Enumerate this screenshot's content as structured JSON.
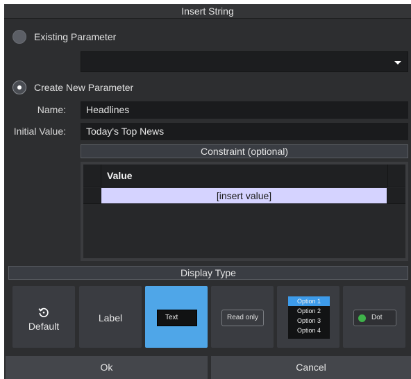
{
  "dialog": {
    "title": "Insert String"
  },
  "existing": {
    "label": "Existing Parameter",
    "selected": false,
    "dropdown_value": ""
  },
  "create": {
    "label": "Create New Parameter",
    "selected": true
  },
  "fields": {
    "name_label": "Name:",
    "name_value": "Headlines",
    "initial_label": "Initial Value:",
    "initial_value": "Today's Top News"
  },
  "constraint": {
    "header": "Constraint (optional)",
    "column": "Value",
    "rows": [
      "[insert value]"
    ]
  },
  "display_type": {
    "header": "Display Type",
    "options": [
      {
        "label": "Default",
        "icon": "reset-icon",
        "selected": false
      },
      {
        "label": "Label",
        "selected": false
      },
      {
        "label": "Text",
        "selected": true
      },
      {
        "label": "Read only",
        "selected": false
      },
      {
        "label": "list",
        "items": [
          "Option 1",
          "Option 2",
          "Option 3",
          "Option 4"
        ],
        "selected_item": "Option 1",
        "selected": false
      },
      {
        "label": "Dot",
        "icon": "green-dot-icon",
        "selected": false
      }
    ]
  },
  "buttons": {
    "ok": "Ok",
    "cancel": "Cancel"
  },
  "colors": {
    "accent": "#4fa6e8",
    "row_highlight": "#d5d3ff",
    "dot": "#3fb24a"
  }
}
